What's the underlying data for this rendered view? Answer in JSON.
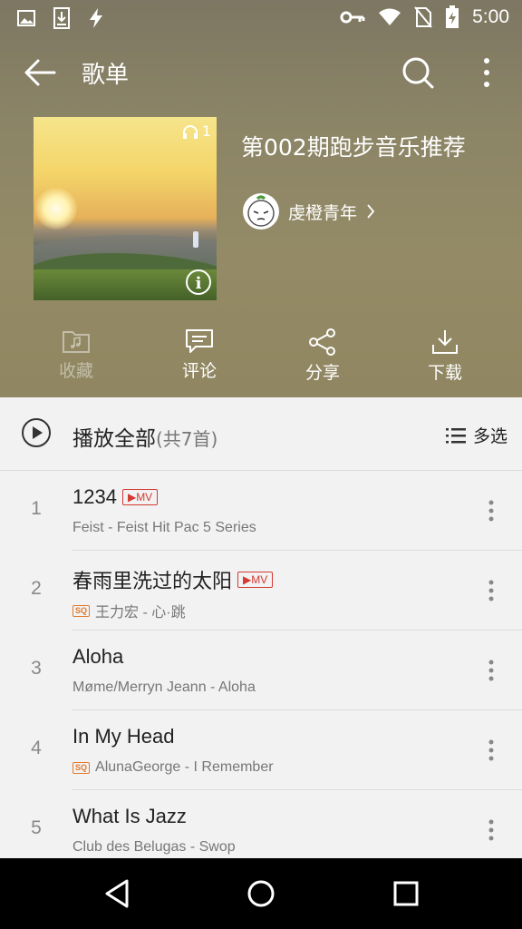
{
  "status_bar": {
    "time": "5:00"
  },
  "app_bar": {
    "title": "歌单"
  },
  "playlist": {
    "title": "第002期跑步音乐推荐",
    "play_count": "1",
    "creator": "虔橙青年"
  },
  "actions": [
    {
      "label": "收藏",
      "icon": "favorite-folder-icon",
      "enabled": false
    },
    {
      "label": "评论",
      "icon": "comment-icon",
      "enabled": true
    },
    {
      "label": "分享",
      "icon": "share-icon",
      "enabled": true
    },
    {
      "label": "下载",
      "icon": "download-icon",
      "enabled": true
    }
  ],
  "list_header": {
    "play_all_label": "播放全部",
    "count_label": "(共7首)",
    "multi_select_label": "多选"
  },
  "songs": [
    {
      "index": "1",
      "title": "1234",
      "mv": "MV",
      "sq": "",
      "subtitle": "Feist - Feist Hit Pac   5 Series"
    },
    {
      "index": "2",
      "title": "春雨里洗过的太阳",
      "mv": "MV",
      "sq": "SQ",
      "subtitle": "王力宏 - 心·跳"
    },
    {
      "index": "3",
      "title": "Aloha",
      "mv": "",
      "sq": "",
      "subtitle": "Møme/Merryn Jeann - Aloha"
    },
    {
      "index": "4",
      "title": "In My Head",
      "mv": "",
      "sq": "SQ",
      "subtitle": "AlunaGeorge - I Remember"
    },
    {
      "index": "5",
      "title": "What Is Jazz",
      "mv": "",
      "sq": "",
      "subtitle": "Club des Belugas - Swop"
    }
  ],
  "colors": {
    "accent_red": "#d33a31",
    "sq_orange": "#e07a2f",
    "hero_bg": "#8b8466"
  }
}
